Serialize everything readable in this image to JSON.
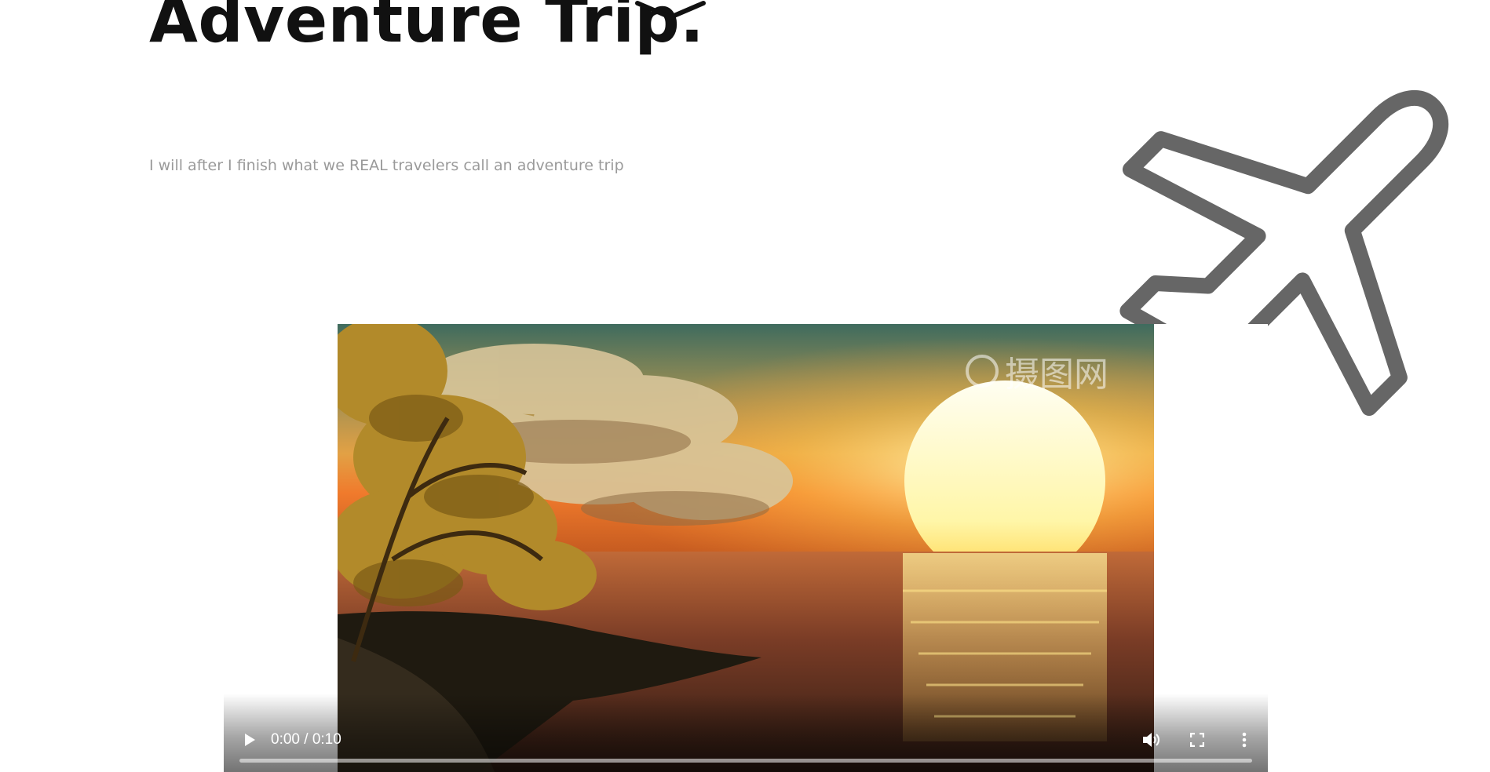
{
  "header": {
    "title": "Adventure Trip.",
    "subtitle": "I will after I finish what we REAL travelers call an adventure trip"
  },
  "video": {
    "current_time": "0:00",
    "duration": "0:10",
    "time_display": "0:00 / 0:10",
    "progress_fraction": 0,
    "watermark_text": "摄图网"
  },
  "icons": {
    "scroll_hint": "chevron-down-icon",
    "decoration": "airplane-icon",
    "play": "play-icon",
    "volume": "volume-icon",
    "fullscreen": "fullscreen-icon",
    "more": "more-vertical-icon"
  },
  "colors": {
    "title": "#111111",
    "subtitle": "#9a9a9a",
    "plane_stroke": "#666666"
  }
}
